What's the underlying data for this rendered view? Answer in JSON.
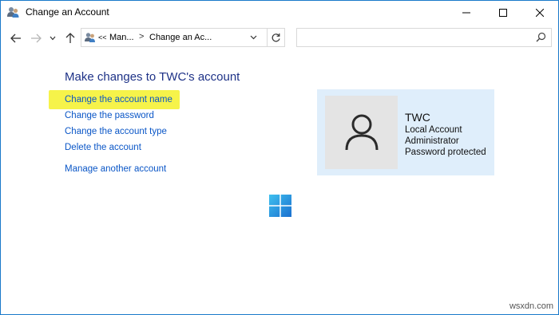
{
  "window": {
    "title": "Change an Account",
    "controls": {
      "minimize": "minimize",
      "maximize": "maximize",
      "close": "close"
    }
  },
  "nav": {
    "back_icon": "back-arrow-icon",
    "forward_icon": "forward-arrow-icon",
    "recent_icon": "chevron-down-icon",
    "up_icon": "up-arrow-icon",
    "address": {
      "prefix": "<<",
      "crumb1": "Man...",
      "separator": ">",
      "crumb2": "Change an Ac..."
    },
    "refresh_icon": "refresh-icon",
    "search": {
      "placeholder": "",
      "icon": "search-icon"
    }
  },
  "main": {
    "heading": "Make changes to TWC's account",
    "links": [
      "Change the account name",
      "Change the password",
      "Change the account type",
      "Delete the account"
    ],
    "manage_link": "Manage another account",
    "highlight_color": "#f6f34a"
  },
  "account_card": {
    "name": "TWC",
    "type": "Local Account",
    "role": "Administrator",
    "status": "Password protected",
    "avatar_icon": "user-avatar-icon"
  },
  "watermark": "wsxdn.com",
  "colors": {
    "link": "#0a56c7",
    "heading": "#1e3287",
    "card_bg": "#dfeefb",
    "accent": "#1979ca"
  }
}
